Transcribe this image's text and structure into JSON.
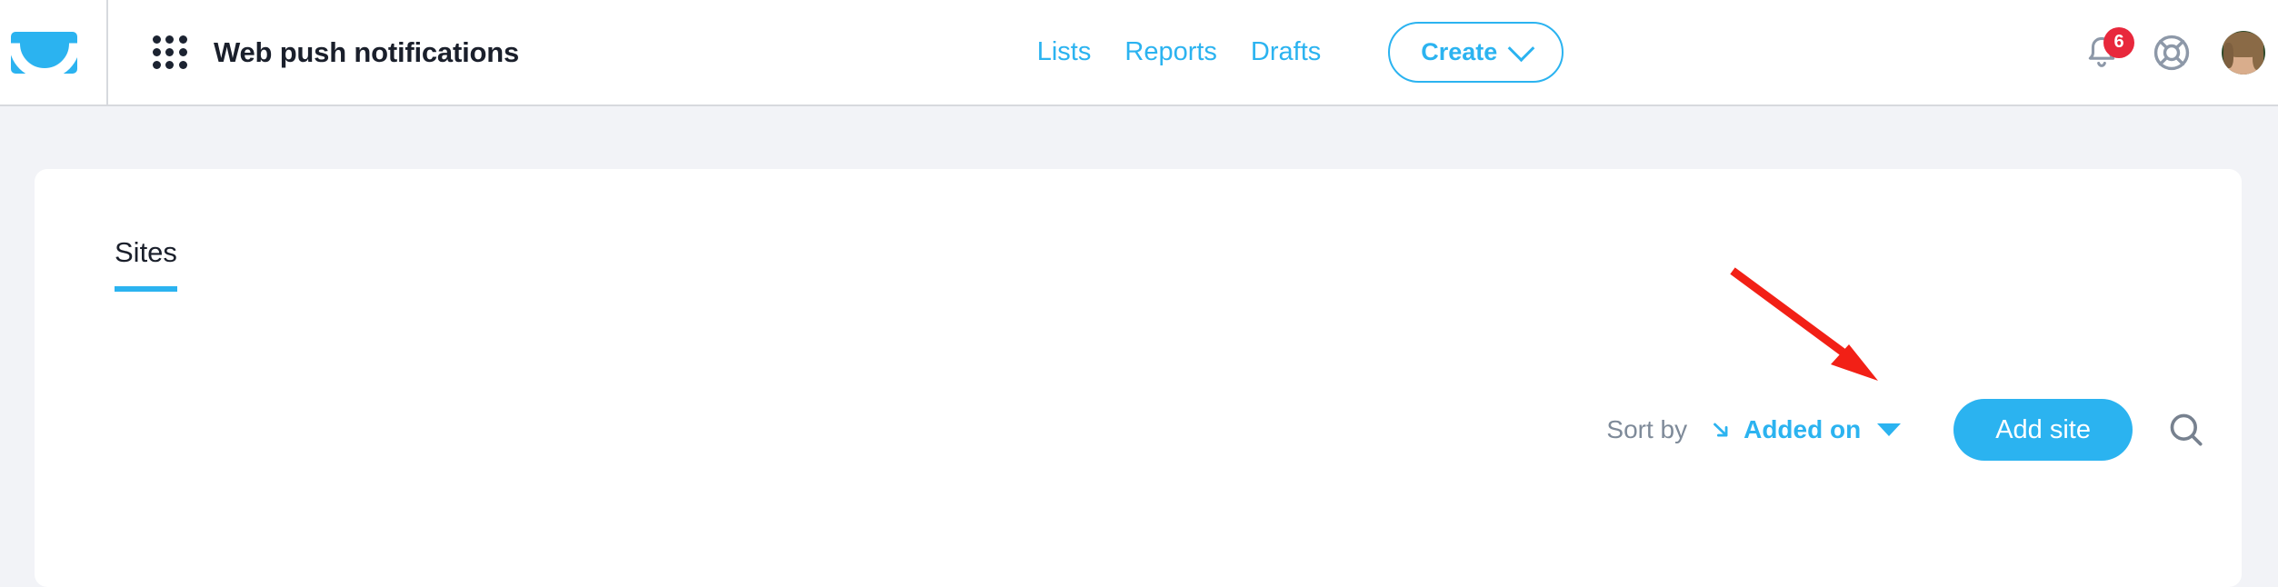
{
  "header": {
    "logo_icon": "getresponse-envelope-logo",
    "apps_grid_icon": "apps-grid-icon",
    "title": "Web push notifications",
    "nav": [
      {
        "label": "Lists",
        "name": "nav-link-lists"
      },
      {
        "label": "Reports",
        "name": "nav-link-reports"
      },
      {
        "label": "Drafts",
        "name": "nav-link-drafts"
      }
    ],
    "create_button": {
      "label": "Create",
      "caret_icon": "chevron-down-icon"
    },
    "notifications": {
      "icon": "bell-icon",
      "badge_count": "6",
      "badge_color": "#e8283c"
    },
    "help": {
      "icon": "lifebuoy-help-icon"
    },
    "avatar": {
      "name": "user-avatar"
    }
  },
  "card": {
    "tabs": [
      {
        "label": "Sites",
        "name": "tab-sites",
        "active": true
      }
    ],
    "toolbar": {
      "sort_label": "Sort by",
      "sort_value": "Added on",
      "sort_direction_icon": "sort-descending-arrow-icon",
      "sort_caret_icon": "caret-down-icon",
      "add_site_label": "Add site",
      "search_icon": "search-icon"
    }
  },
  "annotation": {
    "type": "red-arrow",
    "color": "#f22016",
    "points_to": "Add site"
  },
  "colors": {
    "accent": "#2bb3f0",
    "page_background": "#f2f3f7",
    "card_background": "#ffffff",
    "text_dark": "#1a1f2b",
    "text_muted": "#7e8a99",
    "badge_red": "#e8283c",
    "annotation_red": "#f22016"
  }
}
